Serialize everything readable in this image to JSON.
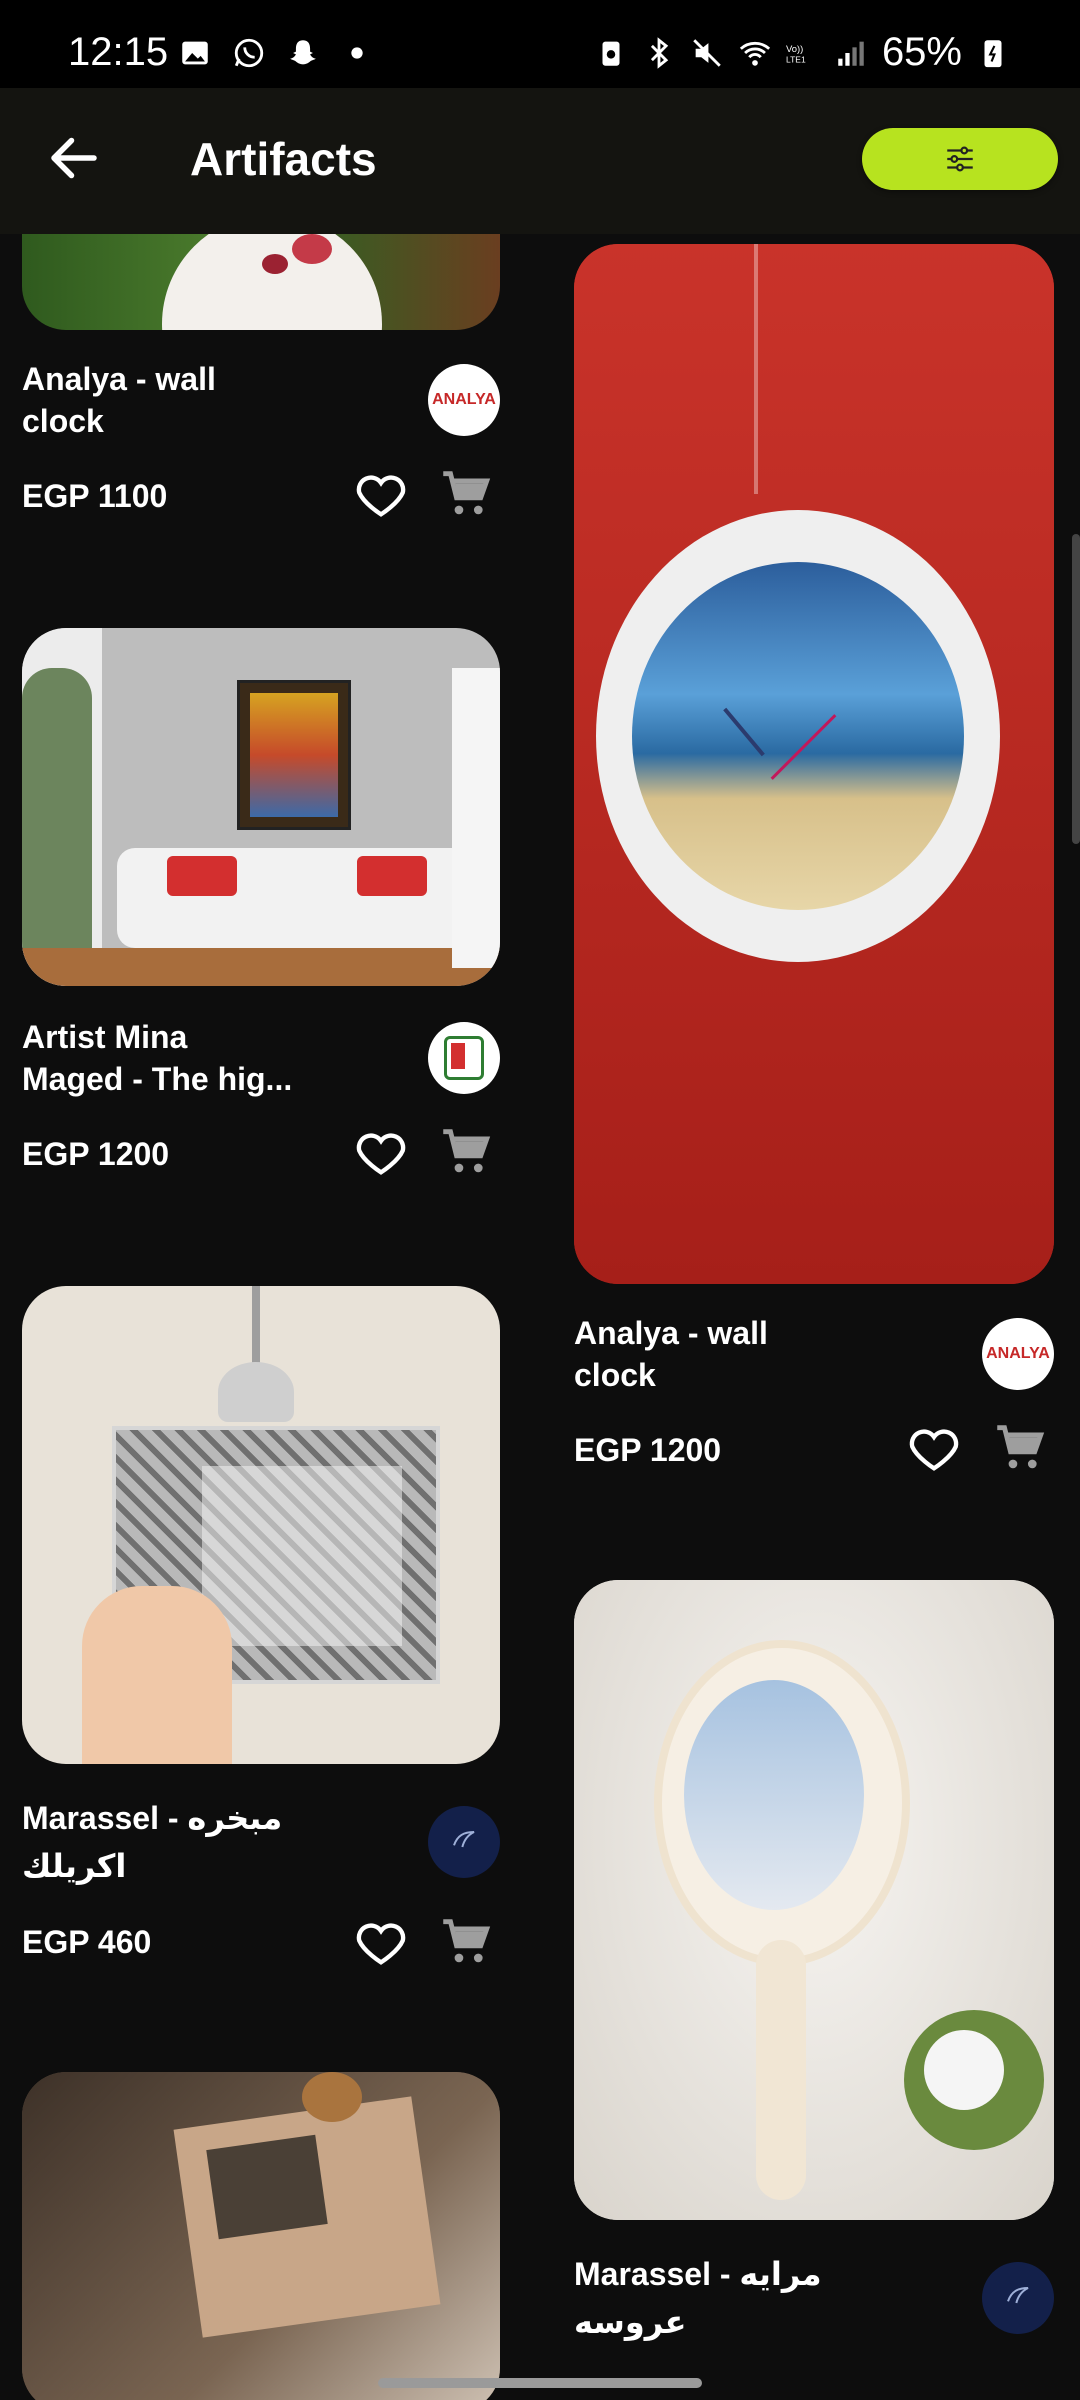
{
  "status_bar": {
    "time": "12:15",
    "battery": "65%",
    "icons": [
      "gallery-icon",
      "whatsapp-icon",
      "snapchat-icon",
      "dot-icon",
      "battery-saver-icon",
      "bluetooth-icon",
      "mute-icon",
      "wifi-icon",
      "volte-icon",
      "signal-icon",
      "battery-icon"
    ]
  },
  "app_bar": {
    "title": "Artifacts",
    "back_icon": "arrow-left-icon",
    "filter_icon": "sliders-icon",
    "filter_color": "#b7e31f"
  },
  "products": [
    {
      "name_line1": "Analya - wall",
      "name_line2": "clock",
      "price": "EGP 1100",
      "vendor": "ANALYA"
    },
    {
      "name_line1": "Artist Mina",
      "name_line2": "Maged  - The hig...",
      "price": "EGP 1200",
      "vendor": ""
    },
    {
      "name_line1": "Marassel - مبخره",
      "name_line2": "اكريلك",
      "price": "EGP 460",
      "vendor": ""
    },
    {
      "name_line1": "",
      "name_line2": "",
      "price": "",
      "vendor": ""
    },
    {
      "name_line1": "Analya - wall",
      "name_line2": "clock",
      "price": "EGP 1200",
      "vendor": "ANALYA"
    },
    {
      "name_line1": "Marassel - مرايه",
      "name_line2": "عروسه",
      "price": "",
      "vendor": ""
    }
  ]
}
